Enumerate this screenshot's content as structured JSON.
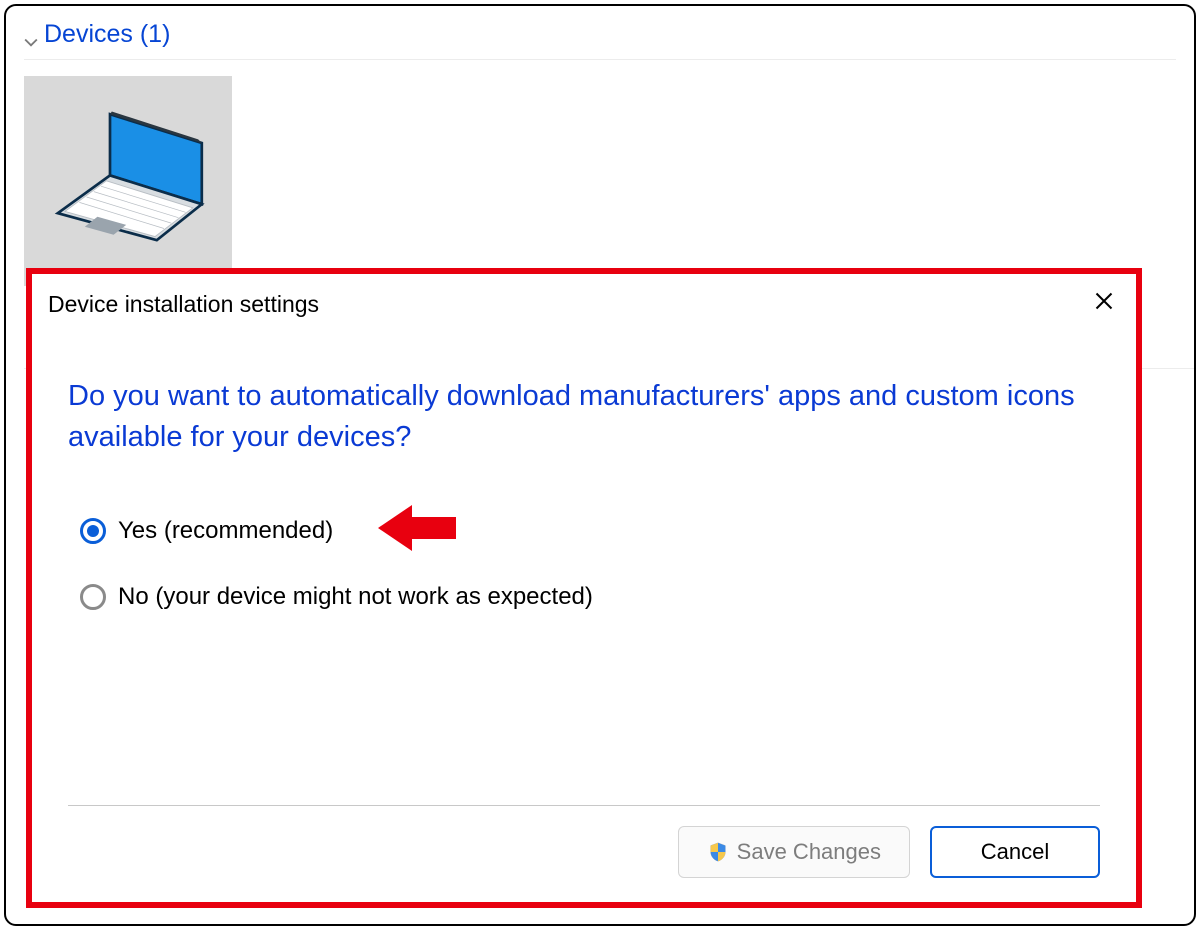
{
  "devices": {
    "section_label": "Devices (1)"
  },
  "dialog": {
    "title": "Device installation settings",
    "question": "Do you want to automatically download manufacturers' apps and custom icons available for your devices?",
    "options": {
      "yes": "Yes (recommended)",
      "no": "No (your device might not work as expected)"
    },
    "buttons": {
      "save": "Save Changes",
      "cancel": "Cancel"
    }
  },
  "colors": {
    "highlight_border": "#e8000f",
    "link_blue": "#0a3ad4",
    "accent": "#0a5ed8"
  }
}
